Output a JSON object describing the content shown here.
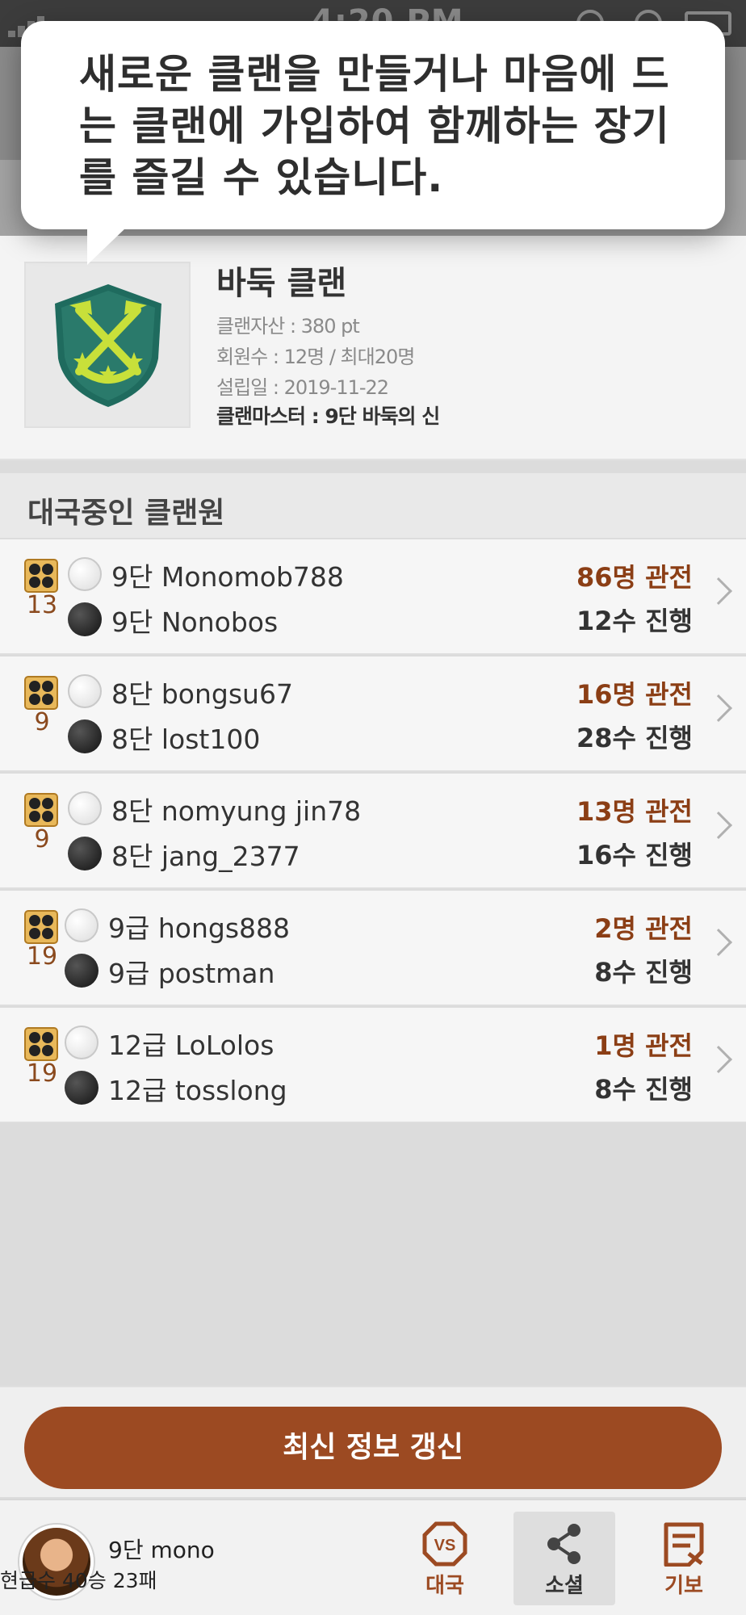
{
  "status_bar": {
    "time": "4:20 PM"
  },
  "tooltip": {
    "message": "새로운 클랜을 만들거나 마음에 드는 클랜에 가입하여 함께하는 장기를 즐길 수 있습니다."
  },
  "clan": {
    "name": "바둑 클랜",
    "assets": "클랜자산 : 380 pt",
    "members": "회원수 : 12명 / 최대20명",
    "founded": "설립일 : 2019-11-22",
    "master": "클랜마스터 : 9단 바둑의 신"
  },
  "section": {
    "title": "대국중인 클랜원"
  },
  "games": [
    {
      "board": "13",
      "white": "9단 Monomob788",
      "black": "9단 Nonobos",
      "viewers": "86명 관전",
      "moves": "12수 진행"
    },
    {
      "board": "9",
      "white": "8단 bongsu67",
      "black": "8단 lost100",
      "viewers": "16명 관전",
      "moves": "28수 진행"
    },
    {
      "board": "9",
      "white": "8단 nomyung jin78",
      "black": "8단 jang_2377",
      "viewers": "13명 관전",
      "moves": "16수 진행"
    },
    {
      "board": "19",
      "white": "9급 hongs888",
      "black": "9급 postman",
      "viewers": "2명 관전",
      "moves": "8수 진행"
    },
    {
      "board": "19",
      "white": "12급 LoLolos",
      "black": "12급 tosslong",
      "viewers": "1명 관전",
      "moves": "8수 진행"
    }
  ],
  "refresh": {
    "label": "최신 정보 갱신"
  },
  "user": {
    "name": "9단 mono",
    "record": "현급수 40승 23패"
  },
  "nav": [
    {
      "label": "대국",
      "icon": "vs-icon"
    },
    {
      "label": "소셜",
      "icon": "share-icon"
    },
    {
      "label": "기보",
      "icon": "record-icon"
    }
  ],
  "colors": {
    "accent": "#9c4a22",
    "viewers": "#8b3e15"
  }
}
